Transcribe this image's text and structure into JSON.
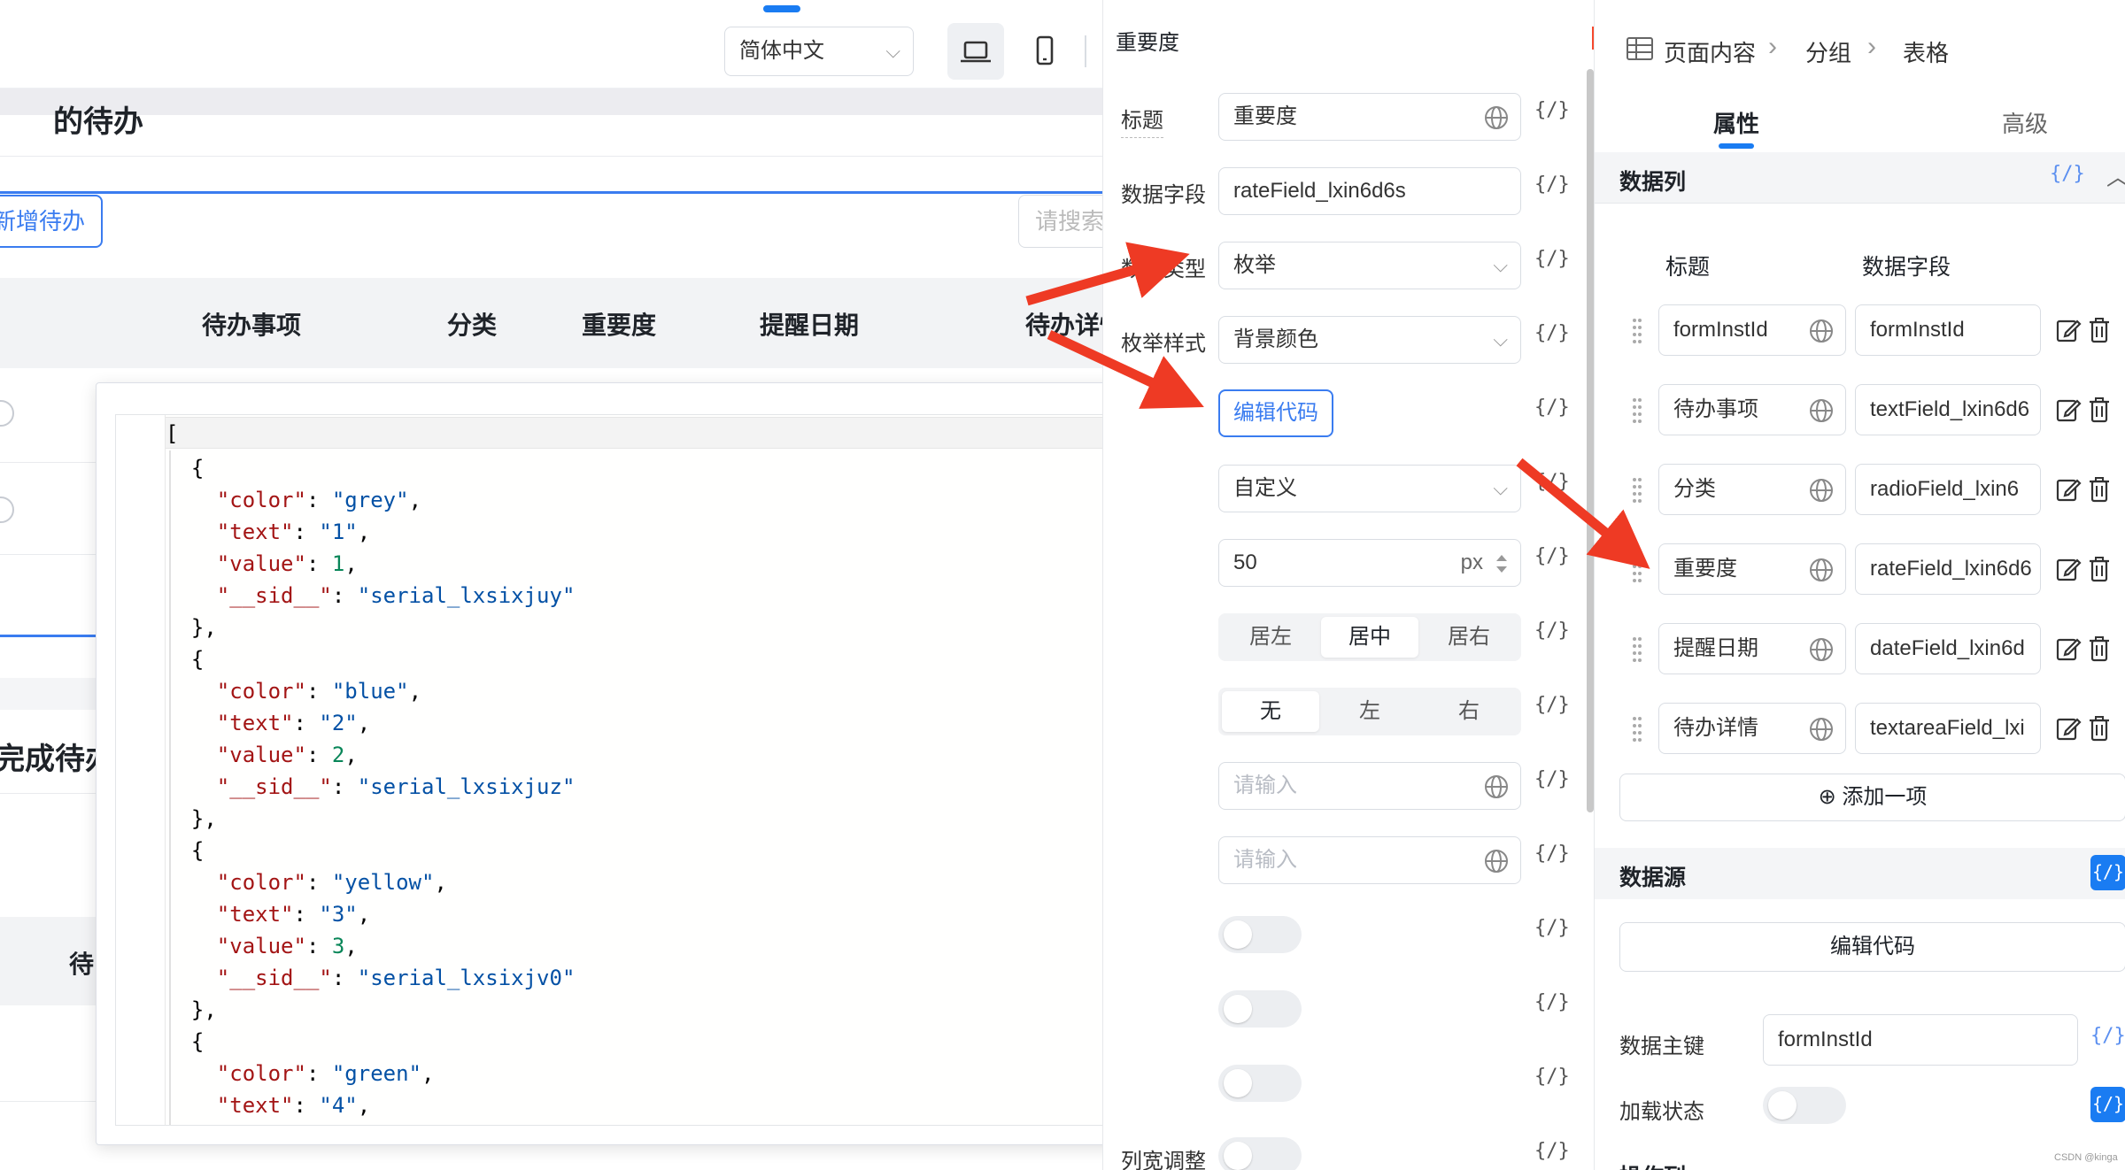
{
  "canvas": {
    "language_select": "简体中文",
    "section1_title": "的待办",
    "add_button": "新增待办",
    "search_placeholder": "请搜索",
    "table_headers": [
      "待办事项",
      "分类",
      "重要度",
      "提醒日期",
      "待办详情"
    ],
    "section2_title": "完成待办",
    "section2_header_first": "待"
  },
  "code_editor": {
    "lines": [
      "[",
      "  {",
      "    \"color\": \"grey\",",
      "    \"text\": \"1\",",
      "    \"value\": 1,",
      "    \"__sid__\": \"serial_lxsixjuy\"",
      "  },",
      "  {",
      "    \"color\": \"blue\",",
      "    \"text\": \"2\",",
      "    \"value\": 2,",
      "    \"__sid__\": \"serial_lxsixjuz\"",
      "  },",
      "  {",
      "    \"color\": \"yellow\",",
      "    \"text\": \"3\",",
      "    \"value\": 3,",
      "    \"__sid__\": \"serial_lxsixjv0\"",
      "  },",
      "  {",
      "    \"color\": \"green\",",
      "    \"text\": \"4\","
    ]
  },
  "props_panel": {
    "title": "重要度",
    "var_label": "{/}",
    "fields": {
      "title_label": "标题",
      "title_value": "重要度",
      "data_field_label": "数据字段",
      "data_field_value": "rateField_lxin6d6s",
      "data_type_label": "数据类型",
      "data_type_value": "枚举",
      "enum_style_label": "枚举样式",
      "enum_style_value": "背景颜色",
      "edit_code": "编辑代码",
      "custom_value": "自定义",
      "width_value": "50",
      "width_unit": "px",
      "align_options": [
        "居左",
        "居中",
        "居右"
      ],
      "align_selected": "居中",
      "fixed_options": [
        "无",
        "左",
        "右"
      ],
      "fixed_selected": "无",
      "input_placeholder_1": "请输入",
      "input_placeholder_2": "请输入",
      "col_resize_label": "列宽调整"
    }
  },
  "config_panel": {
    "breadcrumb": [
      "页面内容",
      "分组",
      "表格"
    ],
    "tabs": [
      "属性",
      "高级"
    ],
    "active_tab": "属性",
    "data_columns_title": "数据列",
    "col_header_title": "标题",
    "col_header_field": "数据字段",
    "columns": [
      {
        "title": "formInstId",
        "field": "formInstId"
      },
      {
        "title": "待办事项",
        "field": "textField_lxin6d6"
      },
      {
        "title": "分类",
        "field": "radioField_lxin6"
      },
      {
        "title": "重要度",
        "field": "rateField_lxin6d6"
      },
      {
        "title": "提醒日期",
        "field": "dateField_lxin6d"
      },
      {
        "title": "待办详情",
        "field": "textareaField_lxi"
      }
    ],
    "add_item": "添加一项",
    "data_source_title": "数据源",
    "edit_code": "编辑代码",
    "primary_key_label": "数据主键",
    "primary_key_value": "formInstId",
    "loading_label": "加载状态",
    "ops_title": "操作列",
    "var_label": "{/}"
  },
  "watermark": "CSDN @kinga",
  "colors": {
    "accent": "#1a7cf2",
    "arrow": "#ee3a24",
    "json_key": "#a31515",
    "json_string": "#0451a5",
    "json_number": "#098658"
  }
}
